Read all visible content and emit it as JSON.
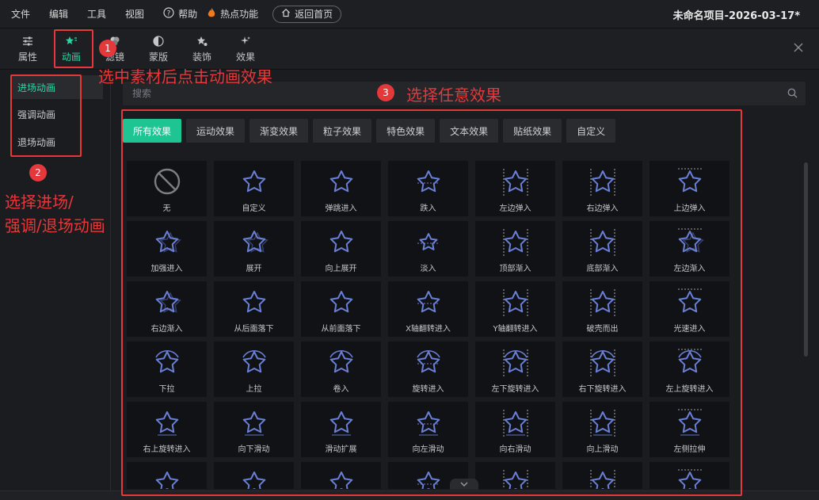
{
  "menu": {
    "items": [
      "文件",
      "编辑",
      "工具",
      "视图"
    ],
    "help": "帮助",
    "hot": "热点功能",
    "home": "返回首页",
    "project_title": "未命名项目-2026-03-17*"
  },
  "tabs": [
    {
      "label": "属性",
      "icon": "sliders-icon"
    },
    {
      "label": "动画",
      "icon": "star-animation-icon"
    },
    {
      "label": "滤镜",
      "icon": "filter-icon"
    },
    {
      "label": "蒙版",
      "icon": "mask-icon"
    },
    {
      "label": "装饰",
      "icon": "decor-icon"
    },
    {
      "label": "效果",
      "icon": "sparkle-icon"
    }
  ],
  "sidebar": {
    "items": [
      "进场动画",
      "强调动画",
      "退场动画"
    ]
  },
  "search": {
    "placeholder": "搜索"
  },
  "categories": [
    "所有效果",
    "运动效果",
    "渐变效果",
    "粒子效果",
    "特色效果",
    "文本效果",
    "贴纸效果",
    "自定义"
  ],
  "effects": [
    "无",
    "自定义",
    "弹跳进入",
    "跌入",
    "左边弹入",
    "右边弹入",
    "上边弹入",
    "加强进入",
    "展开",
    "向上展开",
    "淡入",
    "顶部渐入",
    "底部渐入",
    "左边渐入",
    "右边渐入",
    "从后面落下",
    "从前面落下",
    "X轴翻转进入",
    "Y轴翻转进入",
    "破壳而出",
    "光速进入",
    "下拉",
    "上拉",
    "卷入",
    "旋转进入",
    "左下旋转进入",
    "右下旋转进入",
    "左上旋转进入",
    "右上旋转进入",
    "向下滑动",
    "滑动扩展",
    "向左滑动",
    "向右滑动",
    "向上滑动",
    "左侧拉伸",
    "",
    "",
    "",
    "",
    "",
    "",
    ""
  ],
  "annotations": {
    "n1": "1",
    "t1": "选中素材后点击动画效果",
    "n2": "2",
    "t2a": "选择进场/",
    "t2b": "强调/退场动画",
    "n3": "3",
    "t3": "选择任意效果"
  },
  "colors": {
    "accent": "#2fd3a4",
    "active_bg": "#1fc493",
    "annotation": "#e5383b",
    "star": "#6a7fd6"
  }
}
